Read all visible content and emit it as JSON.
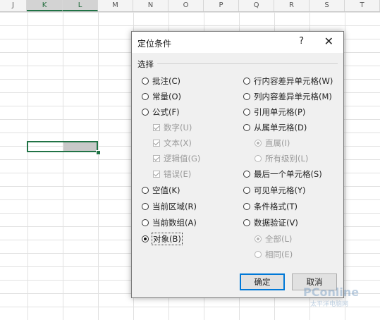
{
  "sheet": {
    "columns": [
      "J",
      "K",
      "L",
      "M",
      "N",
      "O",
      "P",
      "Q",
      "R",
      "S",
      "T"
    ]
  },
  "dialog": {
    "title": "定位条件",
    "help_label": "?",
    "close_label": "✕",
    "group_label": "选择",
    "left_options": [
      {
        "label": "批注(C)",
        "checked": false
      },
      {
        "label": "常量(O)",
        "checked": false
      },
      {
        "label": "公式(F)",
        "checked": false
      },
      {
        "label": "数字(U)",
        "checked": true,
        "sub": true
      },
      {
        "label": "文本(X)",
        "checked": true,
        "sub": true
      },
      {
        "label": "逻辑值(G)",
        "checked": true,
        "sub": true
      },
      {
        "label": "错误(E)",
        "checked": true,
        "sub": true
      },
      {
        "label": "空值(K)",
        "checked": false
      },
      {
        "label": "当前区域(R)",
        "checked": false
      },
      {
        "label": "当前数组(A)",
        "checked": false
      },
      {
        "label": "对象(B)",
        "checked": true
      }
    ],
    "right_options": [
      {
        "label": "行内容差异单元格(W)",
        "checked": false
      },
      {
        "label": "列内容差异单元格(M)",
        "checked": false
      },
      {
        "label": "引用单元格(P)",
        "checked": false
      },
      {
        "label": "从属单元格(D)",
        "checked": false
      },
      {
        "label": "直属(I)",
        "checked": true,
        "sub": true
      },
      {
        "label": "所有级别(L)",
        "checked": false,
        "sub": true
      },
      {
        "label": "最后一个单元格(S)",
        "checked": false
      },
      {
        "label": "可见单元格(Y)",
        "checked": false
      },
      {
        "label": "条件格式(T)",
        "checked": false
      },
      {
        "label": "数据验证(V)",
        "checked": false
      },
      {
        "label": "全部(L)",
        "checked": true,
        "sub": true
      },
      {
        "label": "相同(E)",
        "checked": false,
        "sub": true
      }
    ],
    "ok_label": "确定",
    "cancel_label": "取消"
  },
  "watermark": {
    "text": "PConline",
    "sub": "太平洋电脑网"
  }
}
